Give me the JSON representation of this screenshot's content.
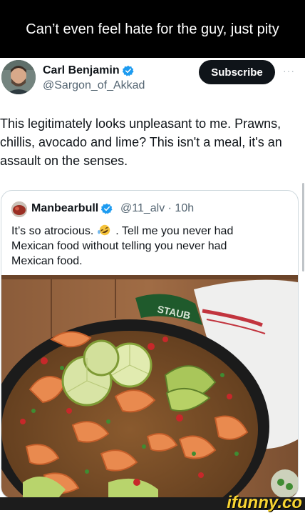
{
  "caption": "Can’t even feel hate for the guy, just pity",
  "tweet": {
    "author_name": "Carl Benjamin",
    "author_handle": "@Sargon_of_Akkad",
    "subscribe_label": "Subscribe",
    "more_label": "···",
    "text": "This legitimately looks unpleasant to me. Prawns, chillis, avocado and lime? This isn't a meal, it's an assault on the senses."
  },
  "quote": {
    "author_name": "Manbearbull",
    "meta": "@11_alv · 10h",
    "text_part1": "It’s so atrocious.",
    "text_part2": ". Tell me you never had Mexican food without telling you never had Mexican food.",
    "emoji": "rolling-on-floor-laughing-emoji",
    "image": {
      "pan_brand": "STAUB",
      "description_icon": "shrimp-rice-skillet-photo"
    }
  },
  "watermark": "ifunny.co",
  "colors": {
    "verified_blue": "#1d9bf0",
    "subscribe_bg": "#0f1419",
    "handle_gray": "#536471",
    "watermark_yellow": "#f8d432"
  }
}
